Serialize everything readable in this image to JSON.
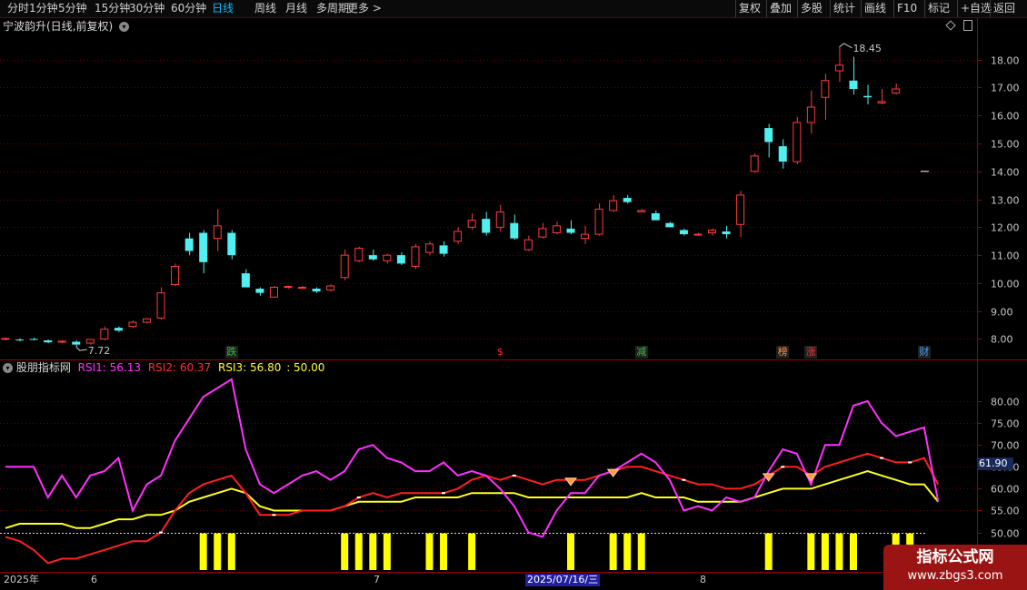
{
  "toolbar": {
    "periods": [
      "分时",
      "1分钟",
      "5分钟",
      "15分钟",
      "30分钟",
      "60分钟",
      "日线",
      "周线",
      "月线",
      "多周期",
      "更多 >"
    ],
    "active_period": "日线",
    "right_buttons": [
      "复权",
      "叠加",
      "多股",
      "统计",
      "画线",
      "F10",
      "标记",
      "+自选",
      "返回"
    ]
  },
  "chart_title": "宁波韵升(日线,前复权)",
  "price_axis": [
    "18.00",
    "17.00",
    "16.00",
    "15.00",
    "14.00",
    "13.00",
    "12.00",
    "11.00",
    "10.00",
    "9.00",
    "8.00"
  ],
  "price_annotations": {
    "high": "18.45",
    "low": "7.72"
  },
  "event_tags": [
    {
      "text": "跌",
      "color": "#30c030"
    },
    {
      "text": "$",
      "color": "#ff3030"
    },
    {
      "text": "减",
      "color": "#30c030"
    },
    {
      "text": "榜",
      "color": "#ff9040"
    },
    {
      "text": "涨",
      "color": "#ff3030"
    },
    {
      "text": "财",
      "color": "#40a0ff"
    }
  ],
  "indicator": {
    "name": "股朋指标网",
    "rsi1_label": "RSI1: 56.13",
    "rsi2_label": "RSI2: 60.37",
    "rsi3_label": "RSI3: 56.80",
    "ref_label": ": 50.00",
    "axis": [
      "80.00",
      "75.00",
      "70.00",
      "65.00",
      "60.00",
      "55.00",
      "50.00"
    ],
    "current_value": "61.90"
  },
  "dates": {
    "year": "2025年",
    "m6": "6",
    "m7": "7",
    "selected": "2025/07/16/三",
    "m8": "8"
  },
  "watermark": {
    "line1": "指标公式网",
    "line2": "www.zbgs3.com"
  },
  "colors": {
    "up": "#ff3c3c",
    "down": "#50f0f0",
    "rsi1": "#ff30ff",
    "rsi2": "#ff2020",
    "rsi3": "#ffff20",
    "bars": "#ffff00",
    "grid": "#6e0000"
  },
  "chart_data": {
    "type": "candlestick",
    "title": "宁波韵升(日线,前复权)",
    "ohlc": [
      [
        8.0,
        8.05,
        7.95,
        8.02
      ],
      [
        7.98,
        8.03,
        7.92,
        7.97
      ],
      [
        8.0,
        8.05,
        7.95,
        7.98
      ],
      [
        7.95,
        7.98,
        7.85,
        7.88
      ],
      [
        7.9,
        7.95,
        7.85,
        7.92
      ],
      [
        7.9,
        7.95,
        7.72,
        7.8
      ],
      [
        7.85,
        8.0,
        7.8,
        7.98
      ],
      [
        8.0,
        8.45,
        7.95,
        8.35
      ],
      [
        8.4,
        8.45,
        8.25,
        8.3
      ],
      [
        8.45,
        8.65,
        8.4,
        8.6
      ],
      [
        8.6,
        8.75,
        8.55,
        8.72
      ],
      [
        8.75,
        9.85,
        8.7,
        9.65
      ],
      [
        9.95,
        10.7,
        9.9,
        10.6
      ],
      [
        11.6,
        11.8,
        11.0,
        11.15
      ],
      [
        11.8,
        11.9,
        10.35,
        10.75
      ],
      [
        11.6,
        12.65,
        11.15,
        12.05
      ],
      [
        11.8,
        11.9,
        10.85,
        11.0
      ],
      [
        10.35,
        10.5,
        9.85,
        9.85
      ],
      [
        9.8,
        9.85,
        9.55,
        9.65
      ],
      [
        9.5,
        9.9,
        9.48,
        9.85
      ],
      [
        9.85,
        9.9,
        9.8,
        9.88
      ],
      [
        9.85,
        9.9,
        9.8,
        9.85
      ],
      [
        9.8,
        9.85,
        9.65,
        9.7
      ],
      [
        9.75,
        9.95,
        9.7,
        9.9
      ],
      [
        10.2,
        11.2,
        10.1,
        11.0
      ],
      [
        10.8,
        11.3,
        10.75,
        11.25
      ],
      [
        11.0,
        11.2,
        10.8,
        10.85
      ],
      [
        10.8,
        11.05,
        10.7,
        11.0
      ],
      [
        11.0,
        11.1,
        10.65,
        10.7
      ],
      [
        10.6,
        11.4,
        10.5,
        11.3
      ],
      [
        11.1,
        11.5,
        11.0,
        11.4
      ],
      [
        11.35,
        11.5,
        10.95,
        11.05
      ],
      [
        11.5,
        12.0,
        11.4,
        11.85
      ],
      [
        12.0,
        12.5,
        11.9,
        12.25
      ],
      [
        12.3,
        12.55,
        11.7,
        11.8
      ],
      [
        12.0,
        12.8,
        11.85,
        12.55
      ],
      [
        12.15,
        12.45,
        11.55,
        11.6
      ],
      [
        11.2,
        11.7,
        11.15,
        11.55
      ],
      [
        11.65,
        12.15,
        11.6,
        11.95
      ],
      [
        11.8,
        12.2,
        11.75,
        12.05
      ],
      [
        11.95,
        12.25,
        11.75,
        11.8
      ],
      [
        11.6,
        12.05,
        11.4,
        11.75
      ],
      [
        11.75,
        12.85,
        11.7,
        12.65
      ],
      [
        12.6,
        13.15,
        12.55,
        12.95
      ],
      [
        13.05,
        13.15,
        12.85,
        12.9
      ],
      [
        12.55,
        12.65,
        12.55,
        12.6
      ],
      [
        12.5,
        12.6,
        12.25,
        12.25
      ],
      [
        12.15,
        12.2,
        12.0,
        12.0
      ],
      [
        11.9,
        11.95,
        11.7,
        11.75
      ],
      [
        11.75,
        11.8,
        11.7,
        11.75
      ],
      [
        11.8,
        11.95,
        11.7,
        11.9
      ],
      [
        11.85,
        12.05,
        11.6,
        11.75
      ],
      [
        12.1,
        13.3,
        11.65,
        13.15
      ],
      [
        14.0,
        14.65,
        13.95,
        14.55
      ],
      [
        15.55,
        15.7,
        14.5,
        15.05
      ],
      [
        14.9,
        15.15,
        14.1,
        14.35
      ],
      [
        14.35,
        15.95,
        14.25,
        15.75
      ],
      [
        15.75,
        16.9,
        15.35,
        16.3
      ],
      [
        16.65,
        17.5,
        15.85,
        17.25
      ],
      [
        17.6,
        18.45,
        17.2,
        17.8
      ],
      [
        17.25,
        18.1,
        16.75,
        16.95
      ],
      [
        16.7,
        17.1,
        16.4,
        16.65
      ],
      [
        16.45,
        16.95,
        16.4,
        16.5
      ],
      [
        16.8,
        17.15,
        16.75,
        16.95
      ]
    ],
    "rsi1": [
      65,
      65,
      65,
      58,
      63,
      58,
      63,
      64,
      67,
      55,
      61,
      63,
      71,
      76,
      81,
      83,
      85,
      69,
      61,
      59,
      61,
      63,
      64,
      62,
      64,
      69,
      70,
      67,
      66,
      64,
      64,
      66,
      63,
      64,
      63,
      60,
      56,
      50,
      49,
      55,
      59,
      59,
      63,
      64,
      66,
      68,
      66,
      62,
      55,
      56,
      55,
      58,
      57,
      58,
      64,
      69,
      68,
      61,
      70,
      70,
      79,
      80,
      75,
      72,
      73,
      74,
      57
    ],
    "rsi2": [
      49,
      48,
      46,
      43,
      44,
      44,
      45,
      46,
      47,
      48,
      48,
      50,
      55,
      59,
      61,
      62,
      63,
      59,
      54,
      54,
      54,
      55,
      55,
      55,
      56,
      58,
      59,
      58,
      59,
      59,
      59,
      59,
      60,
      62,
      63,
      62,
      63,
      62,
      61,
      62,
      62,
      62,
      63,
      64,
      65,
      65,
      64,
      63,
      62,
      61,
      61,
      60,
      60,
      61,
      63,
      65,
      65,
      63,
      65,
      66,
      67,
      68,
      67,
      66,
      66,
      67,
      61
    ],
    "rsi3": [
      51,
      52,
      52,
      52,
      52,
      51,
      51,
      52,
      53,
      53,
      54,
      54,
      55,
      57,
      58,
      59,
      60,
      59,
      56,
      55,
      55,
      55,
      55,
      55,
      56,
      57,
      57,
      57,
      57,
      58,
      58,
      58,
      58,
      59,
      59,
      59,
      59,
      58,
      58,
      58,
      58,
      58,
      58,
      58,
      58,
      59,
      58,
      58,
      58,
      57,
      57,
      57,
      57,
      58,
      59,
      60,
      60,
      60,
      61,
      62,
      63,
      64,
      63,
      62,
      61,
      61,
      57
    ],
    "volume_bar_indices": [
      14,
      15,
      16,
      24,
      25,
      26,
      27,
      30,
      31,
      33,
      40,
      43,
      44,
      45,
      54,
      57,
      58,
      59,
      60,
      63,
      64
    ],
    "y_axis": "price",
    "ylim": [
      7.3,
      18.9
    ],
    "rsi_ylim": [
      41,
      86
    ],
    "ref_line": 50
  }
}
